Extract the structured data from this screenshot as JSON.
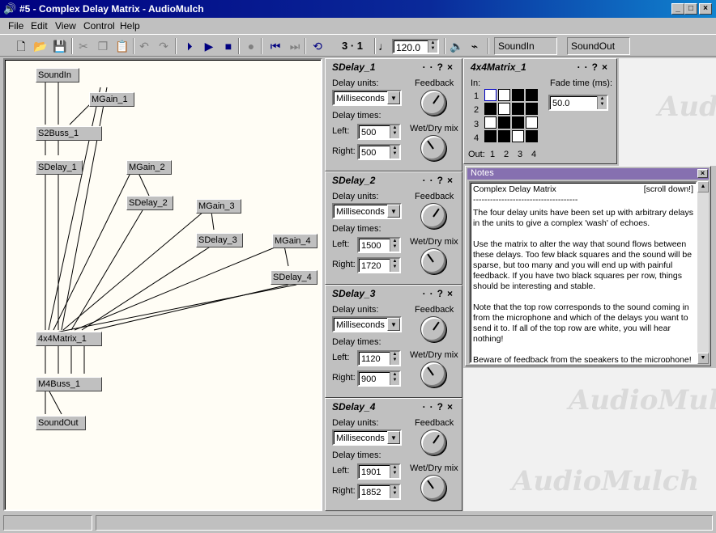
{
  "window": {
    "title": "#5 - Complex Delay Matrix - AudioMulch"
  },
  "menu": [
    "File",
    "Edit",
    "View",
    "Control",
    "Help"
  ],
  "toolbar": {
    "position": "3 · 1",
    "bpm": "120.0",
    "sound_in": "SoundIn",
    "sound_out": "SoundOut"
  },
  "patcher": {
    "nodes": {
      "soundin": "SoundIn",
      "mgain1": "MGain_1",
      "s2buss": "S2Buss_1",
      "sdelay1": "SDelay_1",
      "mgain2": "MGain_2",
      "sdelay2": "SDelay_2",
      "mgain3": "MGain_3",
      "sdelay3": "SDelay_3",
      "mgain4": "MGain_4",
      "sdelay4": "SDelay_4",
      "matrix": "4x4Matrix_1",
      "m4buss": "M4Buss_1",
      "soundout": "SoundOut"
    }
  },
  "sdelays": [
    {
      "title": "SDelay_1",
      "units_label": "Delay units:",
      "units": "Milliseconds",
      "times_label": "Delay times:",
      "left_label": "Left:",
      "left": "500",
      "right_label": "Right:",
      "right": "500",
      "feedback_label": "Feedback",
      "wetdry_label": "Wet/Dry mix"
    },
    {
      "title": "SDelay_2",
      "units_label": "Delay units:",
      "units": "Milliseconds",
      "times_label": "Delay times:",
      "left_label": "Left:",
      "left": "1500",
      "right_label": "Right:",
      "right": "1720",
      "feedback_label": "Feedback",
      "wetdry_label": "Wet/Dry mix"
    },
    {
      "title": "SDelay_3",
      "units_label": "Delay units:",
      "units": "Milliseconds",
      "times_label": "Delay times:",
      "left_label": "Left:",
      "left": "1120",
      "right_label": "Right:",
      "right": "900",
      "feedback_label": "Feedback",
      "wetdry_label": "Wet/Dry mix"
    },
    {
      "title": "SDelay_4",
      "units_label": "Delay units:",
      "units": "Milliseconds",
      "times_label": "Delay times:",
      "left_label": "Left:",
      "left": "1901",
      "right_label": "Right:",
      "right": "1852",
      "feedback_label": "Feedback",
      "wetdry_label": "Wet/Dry mix"
    }
  ],
  "matrix_panel": {
    "title": "4x4Matrix_1",
    "in_label": "In:",
    "out_label": "Out:",
    "row_labels": [
      "1",
      "2",
      "3",
      "4"
    ],
    "col_labels": [
      "1",
      "2",
      "3",
      "4"
    ],
    "fade_label": "Fade time (ms):",
    "fade_value": "50.0",
    "grid": [
      [
        0,
        0,
        1,
        1
      ],
      [
        1,
        0,
        1,
        1
      ],
      [
        0,
        1,
        1,
        0
      ],
      [
        1,
        1,
        0,
        1
      ]
    ]
  },
  "notes": {
    "title": "Notes",
    "heading": "Complex Delay Matrix",
    "scroll_hint": "[scroll down!]",
    "rule": "-------------------------------------",
    "p1": "The four delay units have been set up with arbitrary delays in the units to give a complex 'wash' of echoes.",
    "p2": "Use the matrix to alter the way that sound flows between these delays.  Too few black squares and the sound will be sparse, but too many and you will end up with painful feedback.  If you have two black squares per row, things should be interesting and stable.",
    "p3": "Note that the top row corresponds to the sound coming in from the microphone and which of the delays you want to send it to.  If all of the top row are white, you will hear nothing!",
    "p4": "Beware of feedback from the speakers to the microphone!"
  },
  "watermark": "AudioMulch",
  "colors": {
    "title_bar": "#000080",
    "notes_title": "#8670b0",
    "patcher_bg": "#fffdf5"
  }
}
